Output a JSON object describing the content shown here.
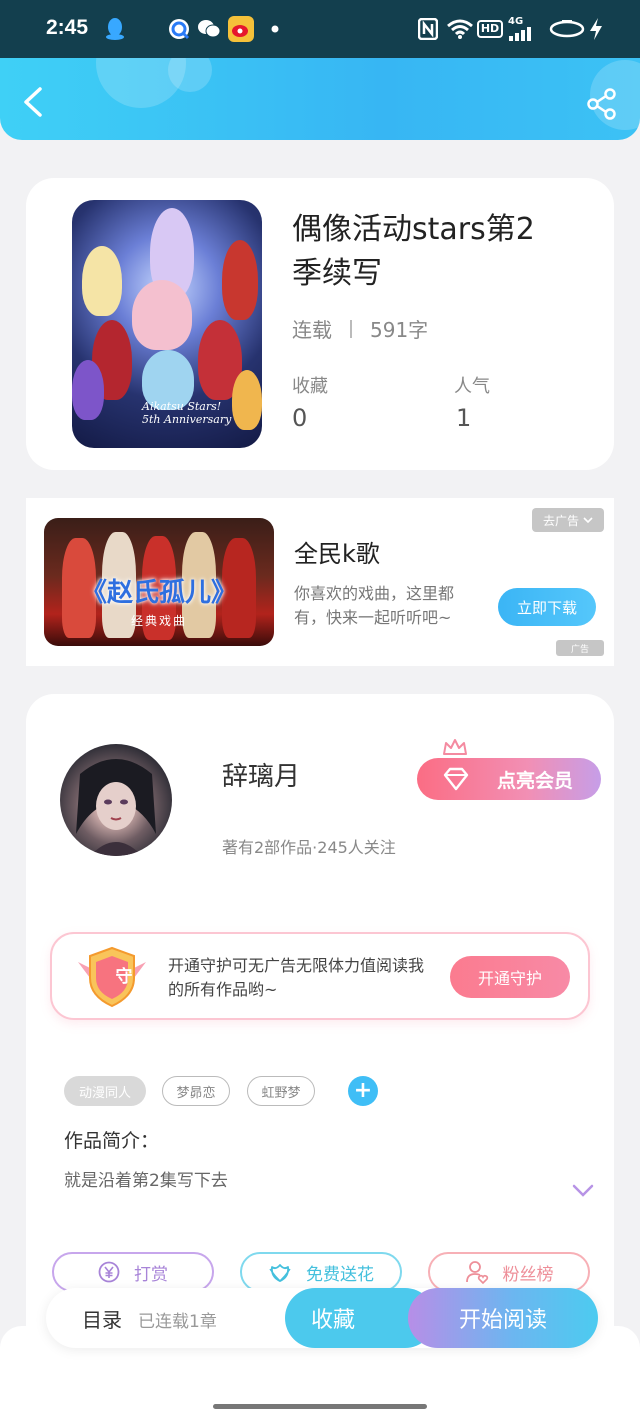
{
  "status_bar": {
    "time": "2:45",
    "left_icons": [
      "qq-icon",
      "browser-icon",
      "wechat-icon",
      "weibo-icon",
      "dot-icon"
    ],
    "right_icons": [
      "nfc-icon",
      "wifi-icon",
      "hd-icon",
      "signal-4g-icon",
      "battery-icon",
      "charging-icon"
    ],
    "hd_label": "HD",
    "net_label": "4G"
  },
  "header": {
    "back_icon": "chevron-left-icon",
    "share_icon": "share-icon",
    "accent": "#3cc2f5"
  },
  "book": {
    "title": "偶像活动stars第2季续写",
    "status": "连载",
    "word_count": "591字",
    "favorites_label": "收藏",
    "favorites_value": "0",
    "popularity_label": "人气",
    "popularity_value": "1",
    "cover_caption_line1": "Aikatsu Stars!",
    "cover_caption_line2": "5th Anniversary"
  },
  "ad": {
    "image_title": "《赵氏孤儿》",
    "image_subtitle": "经典戏曲",
    "title": "全民k歌",
    "description": "你喜欢的戏曲，这里都有，快来一起听听吧~",
    "close_label": "去广告",
    "download_label": "立即下载",
    "ad_mark": "广告"
  },
  "author": {
    "name": "辞璃月",
    "stats": "著有2部作品·245人关注",
    "vip_label": "点亮会员",
    "guard_badge_char": "守",
    "guard_text": "开通守护可无广告无限体力值阅读我的所有作品哟~",
    "guard_button": "开通守护"
  },
  "tags": [
    "动漫同人",
    "梦昴恋",
    "虹野梦"
  ],
  "tag_add_label": "+",
  "intro": {
    "label": "作品简介：",
    "text": "就是沿着第2集写下去"
  },
  "actions": {
    "reward": "打赏",
    "flower": "免费送花",
    "fans": "粉丝榜"
  },
  "bottom_bar": {
    "toc_label": "目录",
    "toc_sub": "已连载1章",
    "collect_label": "收藏",
    "read_label": "开始阅读"
  }
}
